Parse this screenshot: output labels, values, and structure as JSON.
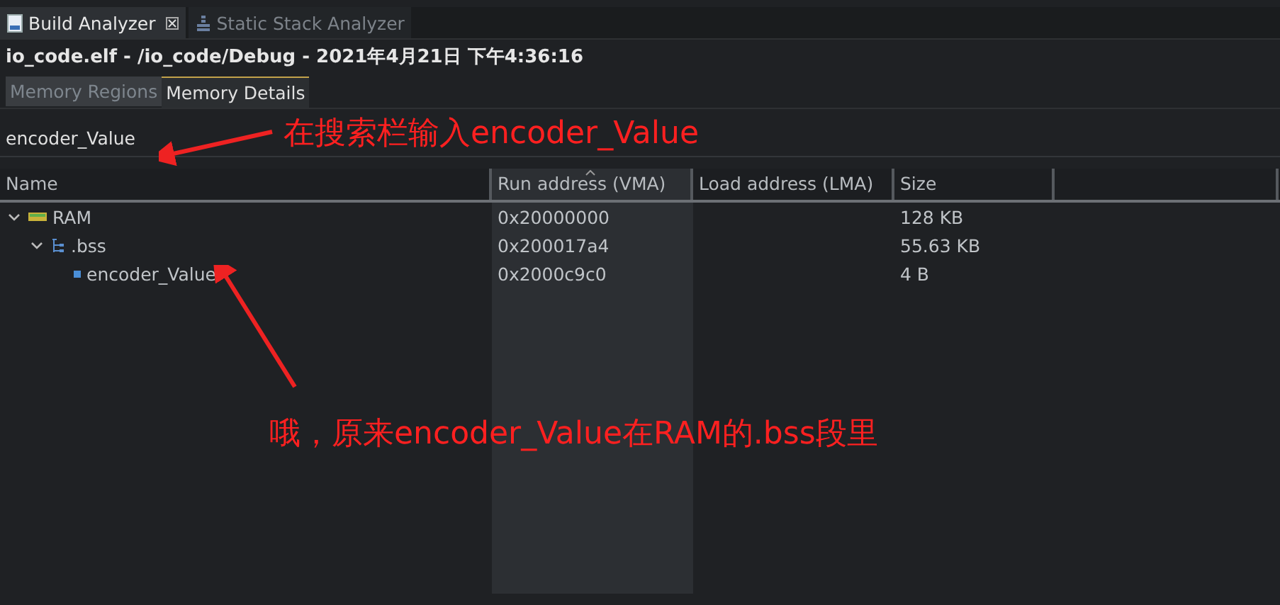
{
  "view_tabs": [
    {
      "label": "Build Analyzer",
      "selected": true,
      "closable": true
    },
    {
      "label": "Static Stack Analyzer",
      "selected": false,
      "closable": false
    }
  ],
  "title": "io_code.elf - /io_code/Debug - 2021年4月21日 下午4:36:16",
  "detail_tabs": [
    {
      "label": "Memory Regions",
      "selected": false
    },
    {
      "label": "Memory Details",
      "selected": true
    }
  ],
  "search": {
    "value": "encoder_Value"
  },
  "table": {
    "columns": [
      {
        "label": "Name",
        "sorted": false
      },
      {
        "label": "Run address (VMA)",
        "sorted": true
      },
      {
        "label": "Load address (LMA)",
        "sorted": false
      },
      {
        "label": "Size",
        "sorted": false
      }
    ],
    "rows": [
      {
        "kind": "region",
        "name": "RAM",
        "run_address": "0x20000000",
        "size": "128 KB",
        "expanded": true,
        "children": [
          {
            "kind": "section",
            "name": ".bss",
            "run_address": "0x200017a4",
            "size": "55.63 KB",
            "expanded": true,
            "children": [
              {
                "kind": "symbol",
                "name": "encoder_Value",
                "run_address": "0x2000c9c0",
                "size": "4 B"
              }
            ]
          }
        ]
      }
    ]
  },
  "annotations": [
    "在搜索栏输入encoder_Value",
    "哦，原来encoder_Value在RAM的.bss段里"
  ]
}
